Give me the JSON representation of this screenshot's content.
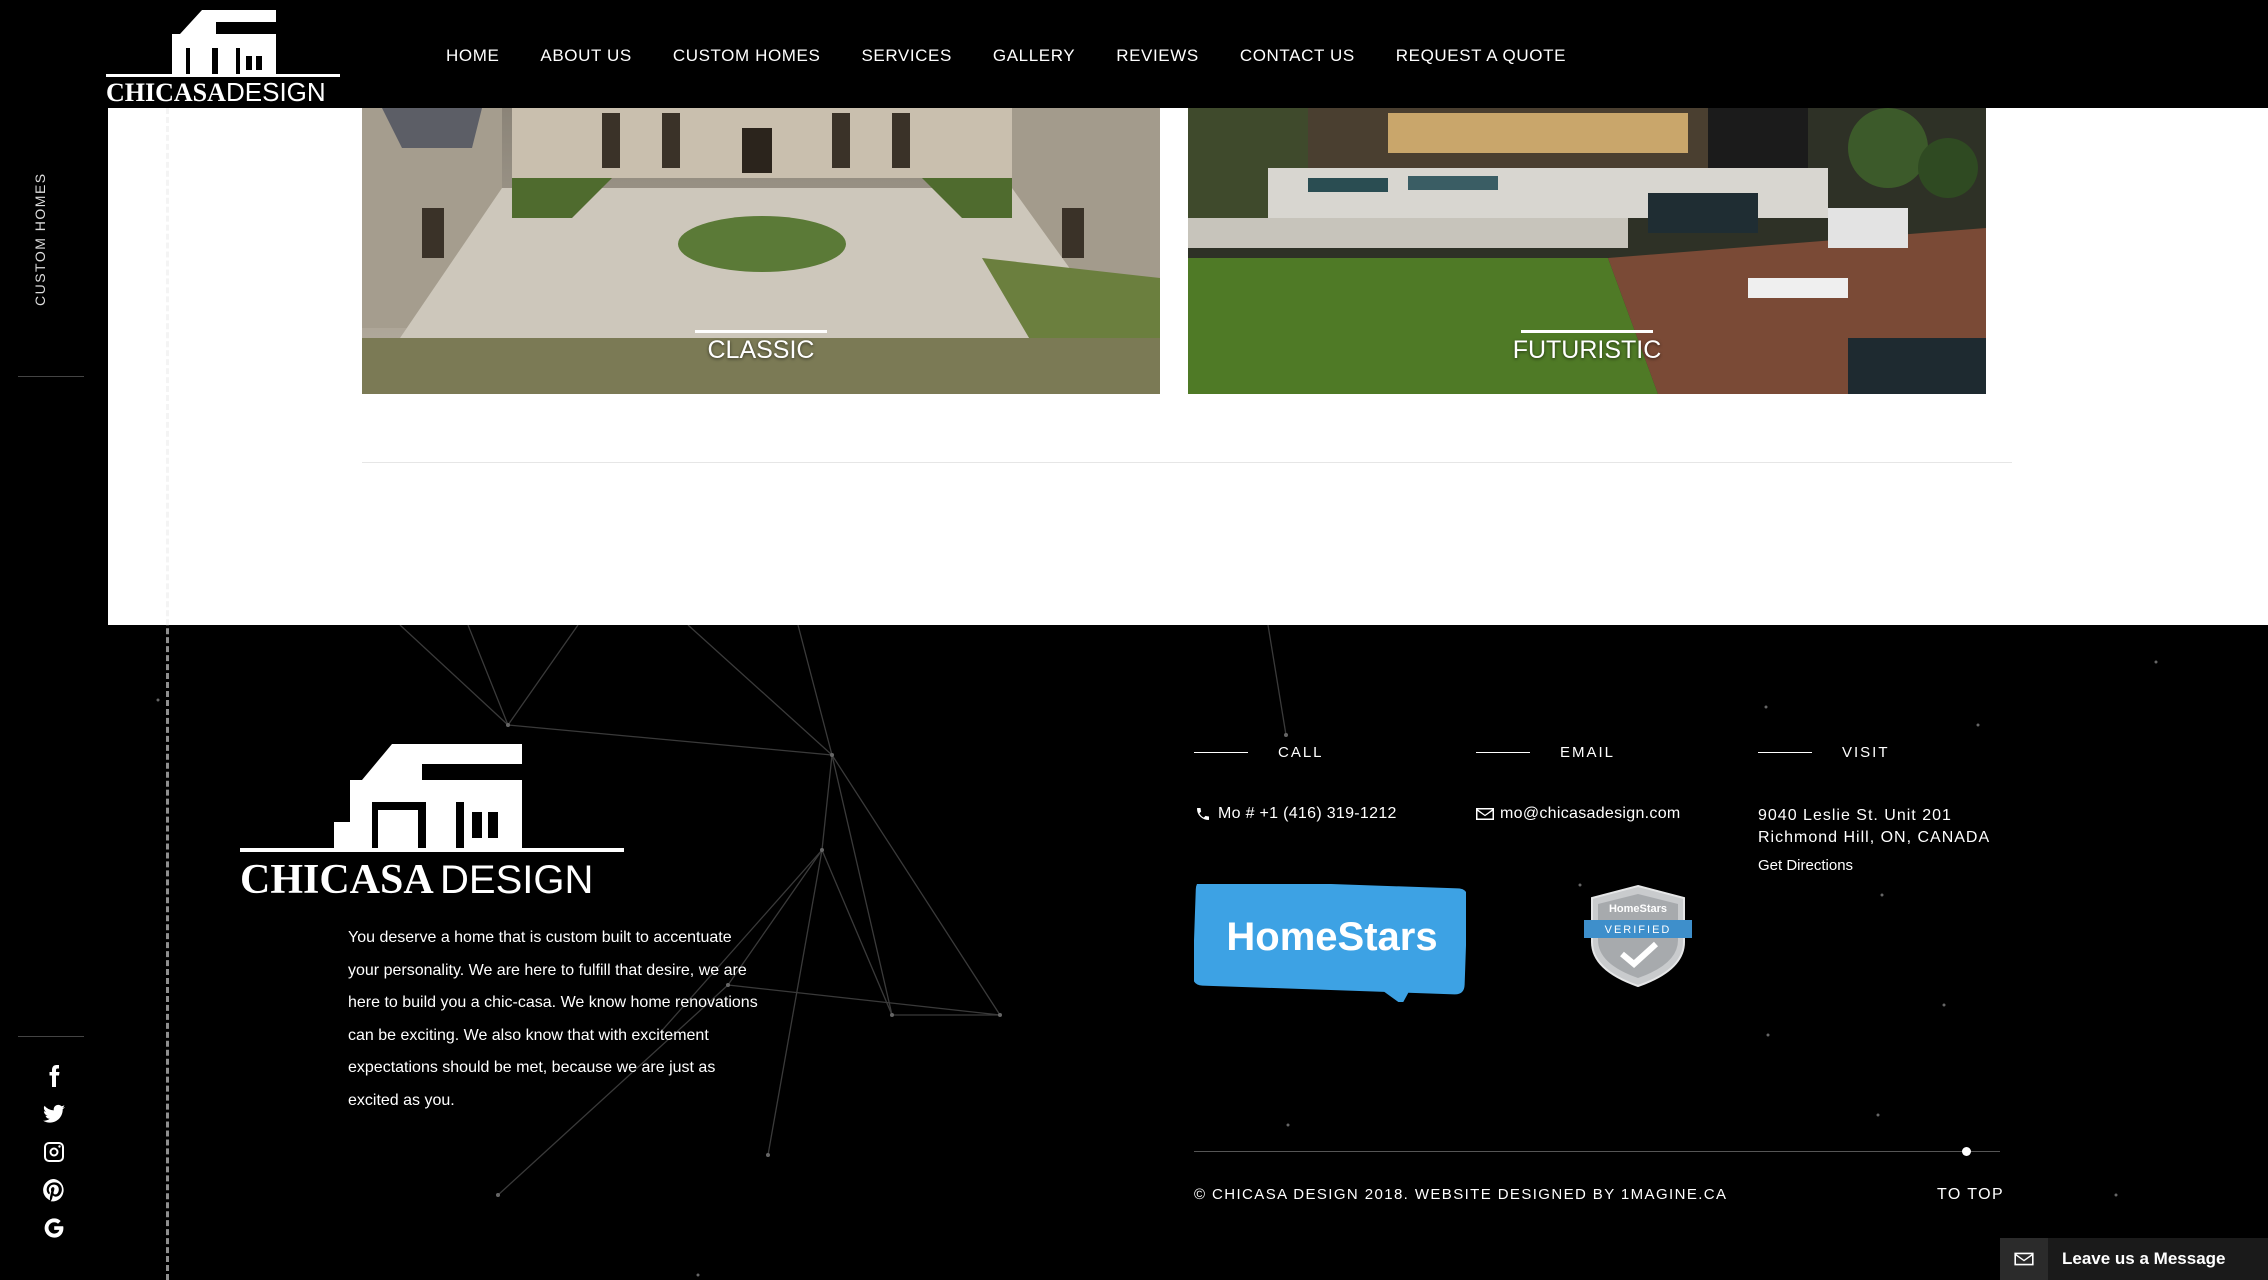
{
  "header": {
    "logo_text": "CHICASADESIGN",
    "nav": [
      {
        "label": "HOME"
      },
      {
        "label": "ABOUT US"
      },
      {
        "label": "CUSTOM HOMES"
      },
      {
        "label": "SERVICES"
      },
      {
        "label": "GALLERY"
      },
      {
        "label": "REVIEWS"
      },
      {
        "label": "CONTACT US"
      },
      {
        "label": "REQUEST A QUOTE"
      }
    ]
  },
  "sidebar": {
    "section_label": "CUSTOM HOMES",
    "social": [
      "facebook-icon",
      "twitter-icon",
      "instagram-icon",
      "pinterest-icon",
      "google-icon"
    ]
  },
  "cards": [
    {
      "title": "CLASSIC"
    },
    {
      "title": "FUTURISTIC"
    }
  ],
  "footer": {
    "logo_text": "CHICASADESIGN",
    "about": "You deserve a home that is custom built to accentuate your personality. We are here to fulfill that desire, we are here to build you a chic-casa. We know home renovations can be exciting. We also know that with excitement expectations should be met, because we are just as excited as you.",
    "call": {
      "heading": "CALL",
      "value": "Mo # +1 (416) 319-1212"
    },
    "email": {
      "heading": "EMAIL",
      "value": "mo@chicasadesign.com"
    },
    "visit": {
      "heading": "VISIT",
      "line1": "9040 Leslie St. Unit 201",
      "line2": "Richmond Hill, ON, CANADA",
      "directions": "Get Directions"
    },
    "badges": {
      "homestars": "HomeStars",
      "verified_top": "HomeStars",
      "verified_ribbon": "VERIFIED"
    },
    "copyright": "© CHICASA DESIGN 2018. WEBSITE DESIGNED BY 1MAGINE.CA",
    "to_top": "TO TOP"
  },
  "chat": {
    "label": "Leave us a Message"
  }
}
